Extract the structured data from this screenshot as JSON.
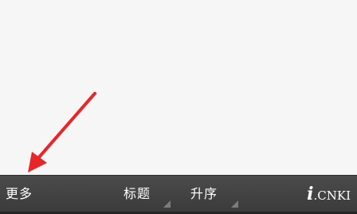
{
  "toolbar": {
    "more_label": "更多",
    "sort_field_label": "标题",
    "sort_order_label": "升序",
    "logo": {
      "prefix": "i",
      "dot": ".",
      "suffix": "CNKI"
    }
  },
  "annotation": {
    "arrow_color": "#e8262a"
  },
  "colors": {
    "toolbar_background": "#424242",
    "page_background": "#f6f6f6",
    "toolbar_text": "#ffffff"
  }
}
